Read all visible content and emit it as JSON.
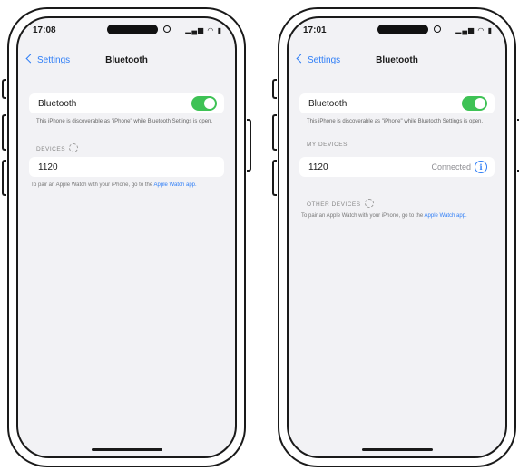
{
  "left": {
    "time": "17:08",
    "back_label": "Settings",
    "title": "Bluetooth",
    "bluetooth_label": "Bluetooth",
    "bluetooth_on": true,
    "discoverable_note": "This iPhone is discoverable as \"iPhone\" while Bluetooth Settings is open.",
    "section_title": "DEVICES",
    "device_name": "1120",
    "footer_text": "To pair an Apple Watch with your iPhone, go to the ",
    "footer_link": "Apple Watch app."
  },
  "right": {
    "time": "17:01",
    "back_label": "Settings",
    "title": "Bluetooth",
    "bluetooth_label": "Bluetooth",
    "bluetooth_on": true,
    "discoverable_note": "This iPhone is discoverable as \"iPhone\" while Bluetooth Settings is open.",
    "my_devices_title": "MY DEVICES",
    "device_name": "1120",
    "device_status": "Connected",
    "other_devices_title": "OTHER DEVICES",
    "footer_text": "To pair an Apple Watch with your iPhone, go to the ",
    "footer_link": "Apple Watch app."
  },
  "colors": {
    "accent": "#2f7ef6",
    "toggle_on": "#3ec255",
    "background": "#f2f2f5"
  }
}
